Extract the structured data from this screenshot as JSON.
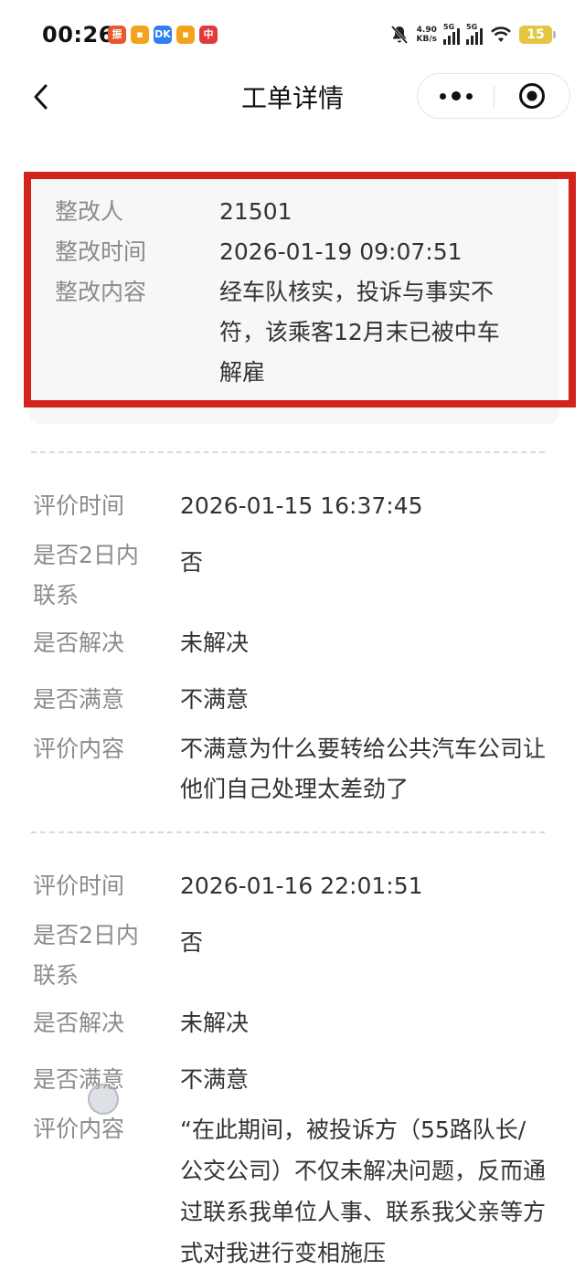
{
  "status_bar": {
    "time": "00:26",
    "notifications": [
      {
        "icon": "app-notification-icon",
        "color": "#e8582c",
        "glyph": "振"
      },
      {
        "icon": "app-notification-icon",
        "color": "#f2a21c",
        "glyph": "▪"
      },
      {
        "icon": "app-notification-icon",
        "color": "#2f7ff0",
        "glyph": "DK"
      },
      {
        "icon": "app-notification-icon",
        "color": "#f2a21c",
        "glyph": "▪"
      },
      {
        "icon": "app-notification-icon",
        "color": "#e03a3a",
        "glyph": "中"
      }
    ],
    "net_speed_value": "4.90",
    "net_speed_unit": "KB/s",
    "signal1_label": "5G",
    "signal2_label": "5G",
    "battery": "15",
    "battery_color": "#e5c642"
  },
  "nav": {
    "title": "工单详情"
  },
  "rectification": {
    "rows": [
      {
        "label": "整改人",
        "value": "21501"
      },
      {
        "label": "整改时间",
        "value": "2026-01-19 09:07:51"
      },
      {
        "label": "整改内容",
        "value": "经车队核实，投诉与事实不符，该乘客12月末已被中车解雇"
      }
    ],
    "highlight_color": "#d3241c"
  },
  "evaluations": [
    {
      "rows": [
        {
          "label": "评价时间",
          "value": "2026-01-15 16:37:45"
        },
        {
          "label": "是否2日内联系",
          "value": "否"
        },
        {
          "label": "是否解决",
          "value": "未解决"
        },
        {
          "label": "是否满意",
          "value": "不满意"
        },
        {
          "label": "评价内容",
          "value": "不满意为什么要转给公共汽车公司让他们自己处理太差劲了"
        }
      ]
    },
    {
      "rows": [
        {
          "label": "评价时间",
          "value": "2026-01-16 22:01:51"
        },
        {
          "label": "是否2日内联系",
          "value": "否"
        },
        {
          "label": "是否解决",
          "value": "未解决"
        },
        {
          "label": "是否满意",
          "value": "不满意"
        },
        {
          "label": "评价内容",
          "value": "“在此期间，被投诉方（55路队长/公交公司）不仅未解决问题，反而通过联系我单位人事、联系我父亲等方式对我进行变相施压"
        }
      ]
    }
  ]
}
